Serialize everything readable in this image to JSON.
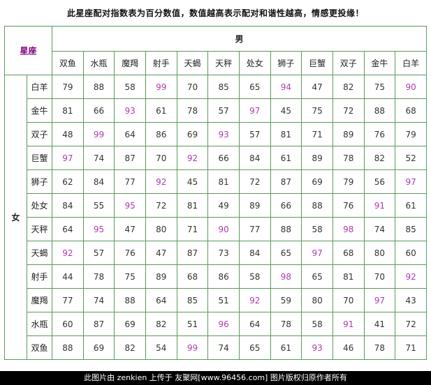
{
  "title": "此星座配对指数表为百分数值，数值越高表示配对和谐性越高，情感更投缘！",
  "corner_label": "星座",
  "male_label": "男",
  "female_label": "女",
  "male_signs": [
    "双鱼",
    "水瓶",
    "魔羯",
    "射手",
    "天蝎",
    "天秤",
    "处女",
    "狮子",
    "巨蟹",
    "双子",
    "金牛",
    "白羊"
  ],
  "female_signs": [
    "白羊",
    "金牛",
    "双子",
    "巨蟹",
    "狮子",
    "处女",
    "天秤",
    "天蝎",
    "射手",
    "魔羯",
    "水瓶",
    "双鱼"
  ],
  "colors": {
    "grid": "#5a9a5a",
    "normal": "#333333",
    "highlight": "#b03ab0",
    "corner": "#800080",
    "footer_bg": "#000000"
  },
  "highlight_threshold": 90,
  "scores": [
    [
      79,
      88,
      58,
      99,
      70,
      85,
      65,
      94,
      47,
      82,
      75,
      90
    ],
    [
      81,
      66,
      93,
      61,
      78,
      57,
      97,
      45,
      75,
      72,
      88,
      68
    ],
    [
      48,
      99,
      64,
      86,
      69,
      93,
      57,
      81,
      71,
      89,
      76,
      79
    ],
    [
      97,
      74,
      87,
      70,
      92,
      66,
      84,
      61,
      89,
      78,
      82,
      52
    ],
    [
      62,
      84,
      77,
      92,
      45,
      81,
      72,
      87,
      69,
      79,
      56,
      97
    ],
    [
      84,
      55,
      95,
      72,
      81,
      49,
      89,
      66,
      88,
      76,
      91,
      61
    ],
    [
      64,
      95,
      47,
      80,
      71,
      90,
      77,
      88,
      58,
      98,
      74,
      85
    ],
    [
      92,
      57,
      76,
      47,
      87,
      73,
      84,
      65,
      97,
      68,
      80,
      60
    ],
    [
      44,
      78,
      75,
      89,
      68,
      86,
      58,
      98,
      65,
      81,
      70,
      92
    ],
    [
      77,
      74,
      88,
      64,
      85,
      51,
      92,
      59,
      80,
      70,
      97,
      43
    ],
    [
      60,
      87,
      69,
      82,
      51,
      96,
      64,
      78,
      58,
      91,
      41,
      72
    ],
    [
      88,
      69,
      82,
      54,
      99,
      74,
      65,
      61,
      93,
      46,
      78,
      71
    ]
  ],
  "footer": "此图片由 zenkien 上传于 友聚网[www.96456.com] 图片版权归原作者所有"
}
